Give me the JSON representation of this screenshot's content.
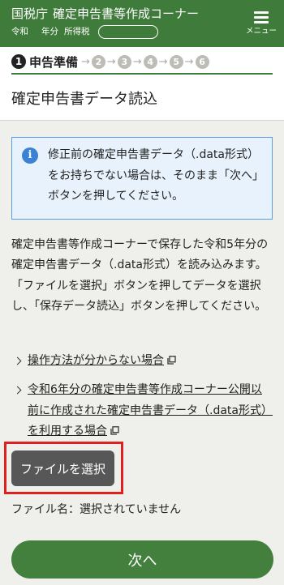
{
  "header": {
    "agency": "国税庁",
    "title": "確定申告書等作成コーナー",
    "era": "令和",
    "year_unit": "年分",
    "tax_type": "所得税",
    "year_badge": "",
    "menu_label": "メニュー",
    "menu_icon": "hamburger-icon"
  },
  "steps": {
    "current_number": "1",
    "current_label": "申告準備",
    "others": [
      "2",
      "3",
      "4",
      "5",
      "6"
    ]
  },
  "page_title": "確定申告書データ読込",
  "info": {
    "icon": "info-icon",
    "text": "修正前の確定申告書データ（.data形式）をお持ちでない場合は、そのまま「次へ」ボタンを押してください。"
  },
  "description": {
    "p1": "確定申告書等作成コーナーで保存した令和5年分の確定申告書データ（.data形式）を読み込みます。",
    "p2": "「ファイルを選択」ボタンを押してデータを選択し、「保存データ読込」ボタンを押してください。"
  },
  "links": [
    {
      "text": "操作方法が分からない場合",
      "icon": "external-window-icon"
    },
    {
      "text": "令和6年分の確定申告書等作成コーナー公開以前に作成された確定申告書データ（.data形式）を利用する場合",
      "icon": "external-window-icon"
    }
  ],
  "file": {
    "button_label": "ファイルを選択",
    "name_label": "ファイル名：",
    "name_value": "選択されていません"
  },
  "next": {
    "label": "次へ"
  },
  "colors": {
    "header_bg": "#3f7b3a",
    "next_bg": "#43803d",
    "info_bg": "#e8f2fc",
    "info_border": "#5a9ee0",
    "highlight": "#e0201f",
    "file_button_bg": "#575757",
    "page_bg": "#efefeb"
  }
}
